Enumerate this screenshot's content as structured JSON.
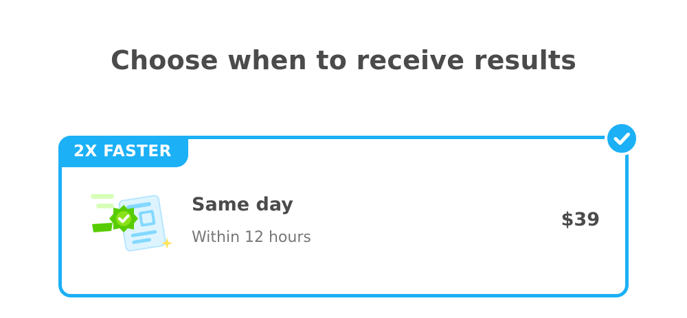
{
  "page": {
    "title": "Choose when to receive results"
  },
  "option": {
    "badge": "2X FASTER",
    "title": "Same day",
    "subtitle": "Within 12 hours",
    "price": "$39",
    "selected": true,
    "illustration_icon": "fast-certificate-icon",
    "selected_icon": "check-icon"
  },
  "colors": {
    "accent": "#1cb0f6",
    "title_text": "#4b4b4b",
    "subtitle_text": "#777777",
    "illustration_green": "#58cc02",
    "illustration_blue": "#84d8ff",
    "sparkle": "#ffe45c"
  }
}
